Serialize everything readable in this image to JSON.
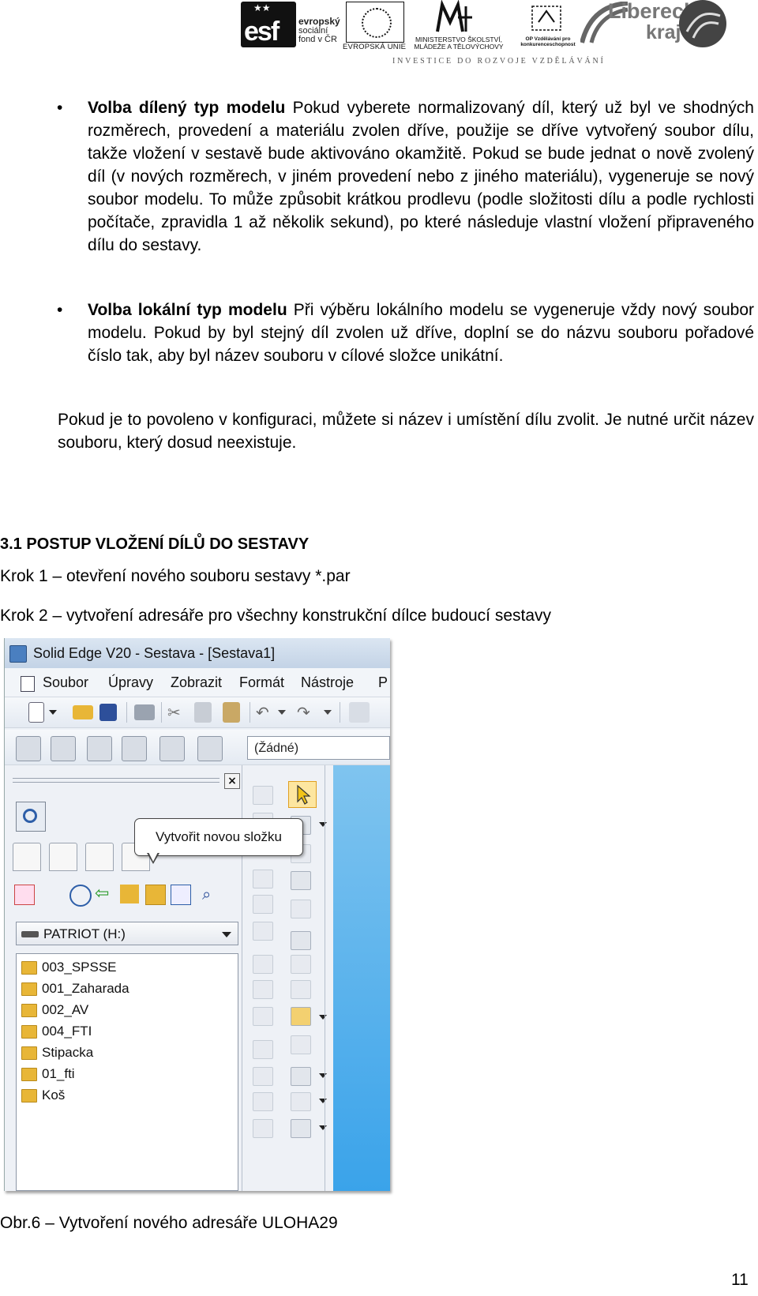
{
  "header": {
    "esf_text": "esf",
    "esf_words": [
      "evropský",
      "sociální",
      "fond v ČR"
    ],
    "eu_label": "EVROPSKÁ UNIE",
    "msmt_label": "MINISTERSTVO ŠKOLSTVÍ, MLÁDEŽE A TĚLOVÝCHOVY",
    "op_label": "OP Vzdělávání pro konkurenceschopnost",
    "liberecky": "Liberecký",
    "kraj": "kraj",
    "tagline": "INVESTICE DO ROZVOJE VZDĚLÁVÁNÍ"
  },
  "bullets": [
    {
      "bold": "Volba dílený typ modelu",
      "text": " Pokud vyberete normalizovaný díl, který už byl ve shodných rozměrech, provedení a materiálu zvolen dříve, použije se dříve vytvořený soubor dílu, takže vložení v sestavě bude aktivováno okamžitě. Pokud se bude jednat o nově zvolený díl (v nových rozměrech, v jiném provedení nebo z jiného materiálu), vygeneruje se nový soubor modelu. To může způsobit krátkou prodlevu (podle složitosti dílu a podle rychlosti počítače, zpravidla 1 až několik sekund), po které následuje vlastní vložení připraveného dílu do sestavy."
    },
    {
      "bold": "Volba lokální typ modelu",
      "text": " Při výběru lokálního modelu se vygeneruje vždy nový soubor modelu. Pokud by byl stejný díl zvolen už dříve, doplní se do názvu souboru pořadové číslo tak, aby byl název souboru v cílové složce unikátní."
    }
  ],
  "paragraph": "Pokud je to povoleno v konfiguraci, můžete si název i umístění dílu zvolit. Je nutné určit název souboru, který dosud neexistuje.",
  "section_heading": "3.1 POSTUP VLOŽENÍ DÍLŮ DO SESTAVY",
  "steps": [
    "Krok 1 – otevření nového souboru sestavy *.par",
    "Krok 2 – vytvoření adresáře pro všechny konstrukční dílce budoucí sestavy"
  ],
  "screenshot": {
    "title": "Solid Edge V20 - Sestava - [Sestava1]",
    "menu": [
      "Soubor",
      "Úpravy",
      "Zobrazit",
      "Formát",
      "Nástroje",
      "P"
    ],
    "style_combo": "(Žádné)",
    "tooltip": "Vytvořit novou složku",
    "drive": "PATRIOT (H:)",
    "folders": [
      "003_SPSSE",
      "001_Zaharada",
      "002_AV",
      "004_FTI",
      "Stipacka",
      "01_fti",
      "Koš"
    ],
    "colors": {
      "canvas": "#3aa3ea",
      "folder": "#e8b637",
      "selected_tool": "#fde6a0"
    }
  },
  "caption": "Obr.6 – Vytvoření nového adresáře ULOHA29",
  "page_number": "11"
}
